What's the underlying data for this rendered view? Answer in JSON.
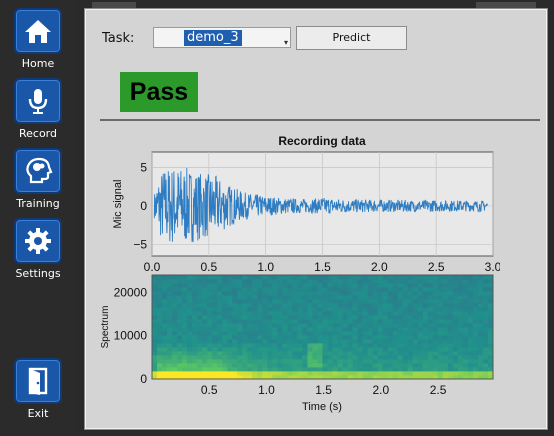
{
  "sidebar": {
    "items": [
      {
        "label": "Home",
        "icon": "home-icon"
      },
      {
        "label": "Record",
        "icon": "microphone-icon"
      },
      {
        "label": "Training",
        "icon": "brain-head-icon"
      },
      {
        "label": "Settings",
        "icon": "gear-icon"
      },
      {
        "label": "Exit",
        "icon": "exit-door-icon"
      }
    ],
    "accent": "#1a57a8"
  },
  "task": {
    "label": "Task:",
    "value": "demo_3"
  },
  "predict_label": "Predict",
  "result": {
    "text": "Pass",
    "color": "#2b9a2b"
  },
  "chart_data": [
    {
      "type": "line",
      "title": "Recording data",
      "ylabel": "Mic signal",
      "xlabel": "",
      "xlim": [
        0,
        3.0
      ],
      "ylim": [
        -6.5,
        7
      ],
      "xticks": [
        "0.0",
        "0.5",
        "1.0",
        "1.5",
        "2.0",
        "2.5",
        "3.0"
      ],
      "yticks": [
        "5",
        "0",
        "−5"
      ],
      "grid": true,
      "color": "#2e7dc3",
      "envelope": {
        "x": [
          0.0,
          0.05,
          0.1,
          0.2,
          0.3,
          0.45,
          0.55,
          0.7,
          0.8,
          1.0,
          1.2,
          1.4,
          1.5,
          1.7,
          2.0,
          2.5,
          2.95
        ],
        "amplitude": [
          0.3,
          3.5,
          5.0,
          5.3,
          5.0,
          4.3,
          4.0,
          2.6,
          1.8,
          1.3,
          1.0,
          0.9,
          1.1,
          0.9,
          0.8,
          0.75,
          0.7
        ]
      }
    },
    {
      "type": "heatmap",
      "title": "",
      "ylabel": "Spectrum",
      "xlabel": "Time (s)",
      "xlim": [
        0,
        2.98
      ],
      "ylim": [
        0,
        24000
      ],
      "xticks": [
        "0.5",
        "1.0",
        "1.5",
        "2.0",
        "2.5"
      ],
      "yticks": [
        "20000",
        "10000",
        "0"
      ],
      "colormap": "viridis"
    }
  ]
}
